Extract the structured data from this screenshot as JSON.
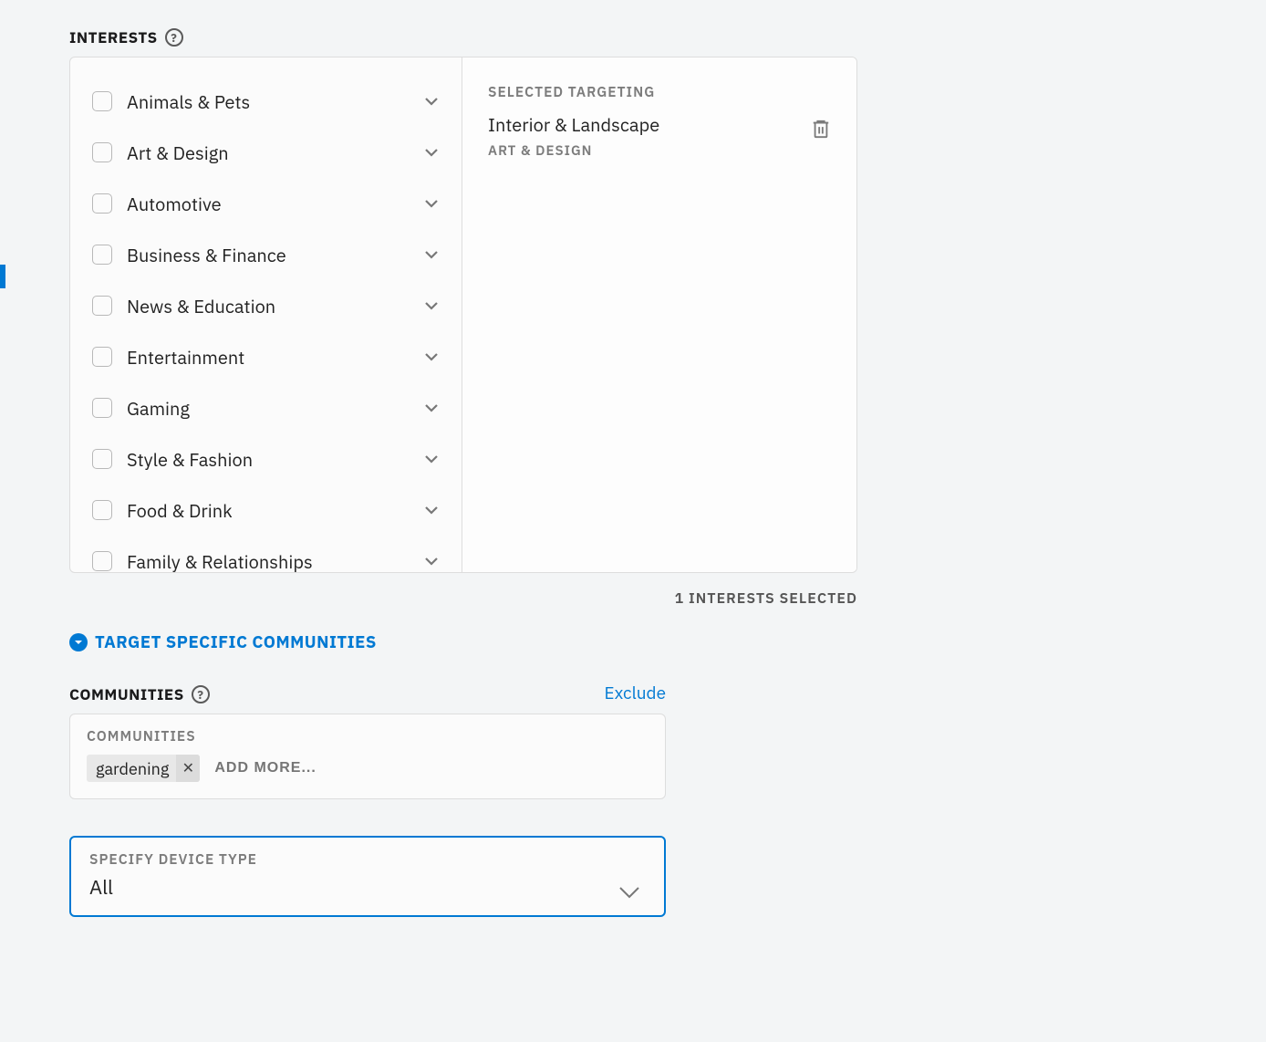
{
  "interests": {
    "title": "INTERESTS",
    "categories": [
      "Animals & Pets",
      "Art & Design",
      "Automotive",
      "Business & Finance",
      "News & Education",
      "Entertainment",
      "Gaming",
      "Style & Fashion",
      "Food & Drink",
      "Family & Relationships"
    ],
    "selected_heading": "SELECTED TARGETING",
    "selected": {
      "name": "Interior & Landscape",
      "parent": "ART & DESIGN"
    },
    "count_text": "1 INTERESTS SELECTED"
  },
  "communities_toggle": "TARGET SPECIFIC COMMUNITIES",
  "communities": {
    "title": "COMMUNITIES",
    "exclude": "Exclude",
    "field_label": "COMMUNITIES",
    "chips": [
      "gardening"
    ],
    "add_placeholder": "ADD MORE..."
  },
  "device": {
    "label": "SPECIFY DEVICE TYPE",
    "value": "All"
  }
}
